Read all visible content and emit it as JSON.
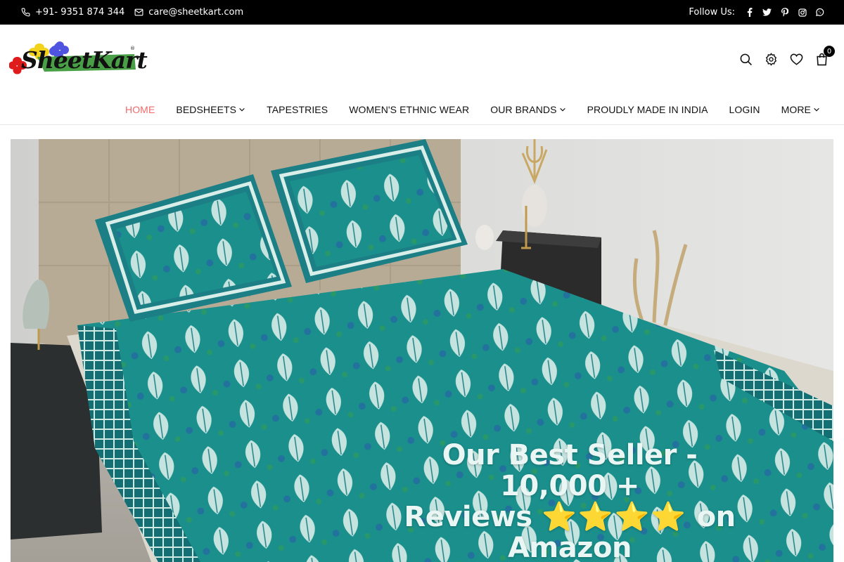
{
  "topbar": {
    "phone": "+91- 9351 874 344",
    "email": "care@sheetkart.com",
    "follow_label": "Follow Us:",
    "social_icons": [
      "facebook-icon",
      "twitter-icon",
      "pinterest-icon",
      "instagram-icon",
      "whatsapp-icon"
    ]
  },
  "header": {
    "logo_text": "SheetKart",
    "logo_reg": "®",
    "cart_count": "0",
    "icons": [
      "search-icon",
      "settings-icon",
      "wishlist-icon",
      "cart-icon"
    ]
  },
  "nav": {
    "items": [
      {
        "label": "HOME",
        "active": true,
        "has_dropdown": false
      },
      {
        "label": "BEDSHEETS",
        "active": false,
        "has_dropdown": true
      },
      {
        "label": "TAPESTRIES",
        "active": false,
        "has_dropdown": false
      },
      {
        "label": "WOMEN'S ETHNIC WEAR",
        "active": false,
        "has_dropdown": false
      },
      {
        "label": "OUR BRANDS",
        "active": false,
        "has_dropdown": true
      },
      {
        "label": "PROUDLY MADE IN INDIA",
        "active": false,
        "has_dropdown": false
      },
      {
        "label": "LOGIN",
        "active": false,
        "has_dropdown": false
      },
      {
        "label": "MORE",
        "active": false,
        "has_dropdown": true
      }
    ]
  },
  "hero": {
    "caption_line1": "Our Best Seller - 10,000 +",
    "caption_line2a": "Reviews",
    "caption_stars": "⭐⭐⭐⭐",
    "caption_line2b": "on",
    "caption_line3": "Amazon"
  },
  "colors": {
    "topbar_bg": "#000000",
    "nav_active": "#f06a6a",
    "bedsheet_teal": "#1a8f8c",
    "caption_text": "#e9f6f4"
  }
}
